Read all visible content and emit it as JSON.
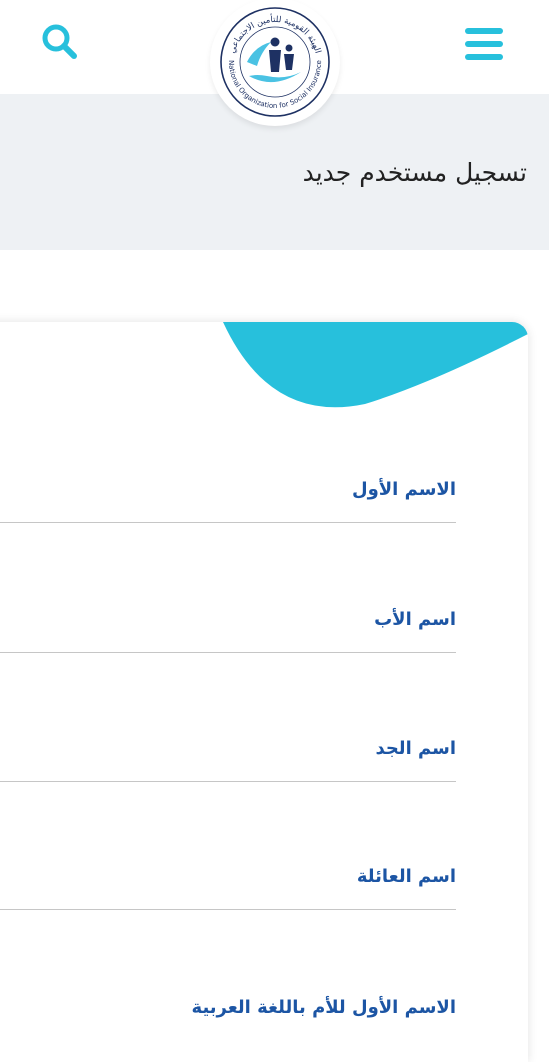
{
  "header": {
    "logo_text_ar": "الهيئة القومية للتأمين الاجتماعي",
    "logo_text_en": "National Organization for Social Insurance",
    "colors": {
      "accent": "#27c0dc",
      "logo_dark": "#1e3163",
      "logo_blue": "#4ac2e3"
    }
  },
  "page": {
    "title": "تسجيل مستخدم جديد"
  },
  "form": {
    "fields": [
      {
        "label": "الاسم الأول"
      },
      {
        "label": "اسم الأب"
      },
      {
        "label": "اسم الجد"
      },
      {
        "label": "اسم العائلة"
      },
      {
        "label": "الاسم الأول للأم باللغة العربية"
      }
    ],
    "label_color": "#1c55a4"
  }
}
